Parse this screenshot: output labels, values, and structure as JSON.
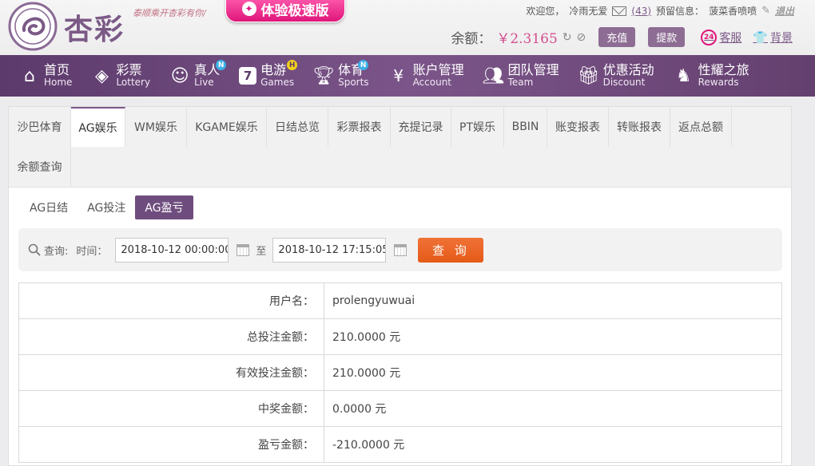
{
  "header": {
    "logo_text": "杏彩",
    "slogan": "泰顺乘开杏彩有你/",
    "fast_version": "体验极速版",
    "welcome": "欢迎您，",
    "username_top": "冷雨无爱",
    "mail_count": "(43)",
    "reserve_label": "预留信息：",
    "reserve_value": "菠菜香喷喷",
    "logout": "退出",
    "balance_label": "余额：",
    "balance_value": "￥2.3165",
    "deposit": "充值",
    "withdraw": "提款",
    "service": "客服",
    "skin": "背景"
  },
  "nav": [
    {
      "cn": "首页",
      "en": "Home",
      "icon": "home-icon",
      "badge": ""
    },
    {
      "cn": "彩票",
      "en": "Lottery",
      "icon": "lottery-icon",
      "badge": ""
    },
    {
      "cn": "真人",
      "en": "Live",
      "icon": "live-icon",
      "badge": "N"
    },
    {
      "cn": "电游",
      "en": "Games",
      "icon": "games-icon",
      "badge": "H"
    },
    {
      "cn": "体育",
      "en": "Sports",
      "icon": "sports-icon",
      "badge": "N"
    },
    {
      "cn": "账户管理",
      "en": "Account",
      "icon": "account-icon",
      "badge": ""
    },
    {
      "cn": "团队管理",
      "en": "Team",
      "icon": "team-icon",
      "badge": ""
    },
    {
      "cn": "优惠活动",
      "en": "Discount",
      "icon": "gift-icon",
      "badge": ""
    },
    {
      "cn": "性耀之旅",
      "en": "Rewards",
      "icon": "rewards-icon",
      "badge": ""
    }
  ],
  "tabs": [
    "沙巴体育",
    "AG娱乐",
    "WM娱乐",
    "KGAME娱乐",
    "日结总览",
    "彩票报表",
    "充提记录",
    "PT娱乐",
    "BBIN",
    "账变报表",
    "转账报表",
    "返点总额",
    "余额查询"
  ],
  "subtabs": [
    "AG日结",
    "AG投注",
    "AG盈亏"
  ],
  "query": {
    "label": "查询:",
    "time_label": "时间：",
    "start": "2018-10-12 00:00:00",
    "to": "至",
    "end": "2018-10-12 17:15:05",
    "button": "查 询"
  },
  "result": [
    {
      "key": "用户名：",
      "value": "prolengyuwuai"
    },
    {
      "key": "总投注金额：",
      "value": "210.0000 元"
    },
    {
      "key": "有效投注金额：",
      "value": "210.0000 元"
    },
    {
      "key": "中奖金额：",
      "value": "0.0000 元"
    },
    {
      "key": "盈亏金额：",
      "value": "-210.0000 元"
    }
  ],
  "colors": {
    "brand": "#7b5589",
    "accent": "#e55a18",
    "balance": "#d24f8e"
  }
}
